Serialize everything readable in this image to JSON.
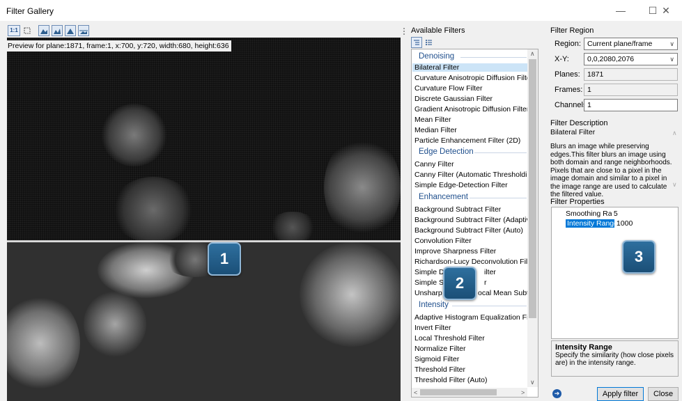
{
  "window": {
    "title": "Filter Gallery",
    "minimize": "—",
    "maximize": "☐",
    "close": "✕"
  },
  "preview": {
    "caption": "Preview for plane:1871, frame:1, x:700, y:720, width:680, height:636",
    "badge_1": "1"
  },
  "available_filters": {
    "title": "Available Filters",
    "badge_2": "2",
    "groups": [
      {
        "name": "Denoising",
        "items": [
          "Bilateral Filter",
          "Curvature Anisotropic Diffusion Filter",
          "Curvature Flow Filter",
          "Discrete Gaussian Filter",
          "Gradient Anisotropic Diffusion Filter",
          "Mean Filter",
          "Median Filter",
          "Particle Enhancement Filter (2D)"
        ]
      },
      {
        "name": "Edge Detection",
        "items": [
          "Canny Filter",
          "Canny Filter (Automatic Thresholding)",
          "Simple Edge-Detection Filter"
        ]
      },
      {
        "name": "Enhancement",
        "items": [
          "Background Subtract Filter",
          "Background Subtract Filter (Adaptive)",
          "Background Subtract Filter (Auto)",
          "Convolution Filter",
          "Improve Sharpness Filter",
          "Richardson-Lucy Deconvolution Filter",
          "Simple De",
          "Simple Sh",
          "Unsharp M"
        ]
      },
      {
        "name": "Intensity",
        "items": [
          "Adaptive Histogram Equalization Filter",
          "Invert Filter",
          "Local Threshold Filter",
          "Normalize Filter",
          "Sigmoid Filter",
          "Threshold Filter",
          "Threshold Filter (Auto)"
        ]
      }
    ],
    "fragments": {
      "simple_de_tail": "ilter",
      "simple_sh_tail": "r",
      "unsharp_tail": "ocal Mean Subtrac"
    }
  },
  "filter_region": {
    "title": "Filter Region",
    "region_label": "Region:",
    "region_value": "Current plane/frame",
    "xy_label": "X-Y:",
    "xy_value": "0,0,2080,2076",
    "planes_label": "Planes:",
    "planes_value": "1871",
    "frames_label": "Frames:",
    "frames_value": "1",
    "channels_label": "Channels:",
    "channels_value": "1"
  },
  "filter_description": {
    "title": "Filter Description",
    "name": "Bilateral Filter",
    "text": "Blurs an image while preserving edges.This filter blurs an image using both domain and range neighborhoods. Pixels that are close to a pixel in the image domain and similar to a pixel in the image range are used to calculate the filtered value."
  },
  "filter_properties": {
    "title": "Filter Properties",
    "badge_3": "3",
    "rows": [
      {
        "key": "Smoothing Radi",
        "value": "5"
      },
      {
        "key": "Intensity Range",
        "value": "1000"
      }
    ],
    "hint_title": "Intensity Range",
    "hint_text": "Specify the similarity (how close pixels are) in the intensity range."
  },
  "buttons": {
    "apply": "Apply filter",
    "close": "Close"
  },
  "toolbar": {
    "zoom_label": "1:1"
  }
}
